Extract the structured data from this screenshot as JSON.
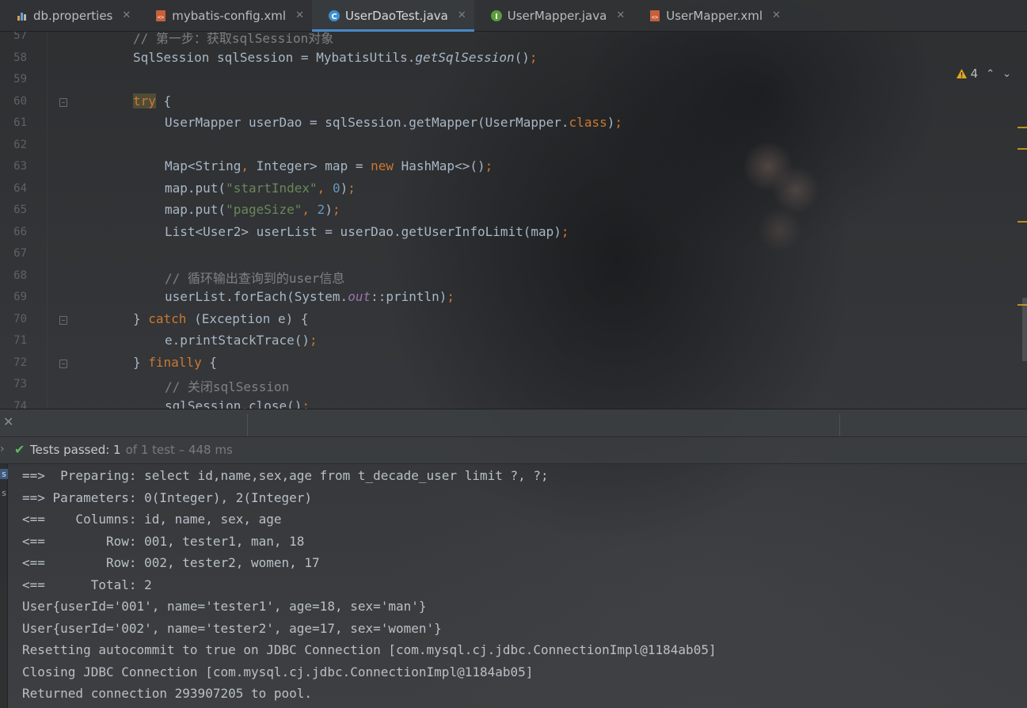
{
  "tabs": [
    {
      "label": "db.properties",
      "icon": "properties-file-icon",
      "active": false
    },
    {
      "label": "mybatis-config.xml",
      "icon": "xml-file-icon",
      "active": false
    },
    {
      "label": "UserDaoTest.java",
      "icon": "java-class-icon",
      "active": true
    },
    {
      "label": "UserMapper.java",
      "icon": "java-interface-icon",
      "active": false
    },
    {
      "label": "UserMapper.xml",
      "icon": "xml-file-icon",
      "active": false
    }
  ],
  "inspections": {
    "warning_count": "4"
  },
  "editor": {
    "lines": [
      {
        "num": "57",
        "indent": 0,
        "tokens": [
          {
            "t": "// 第一步：获取sqlSession对象",
            "c": "cmt"
          }
        ]
      },
      {
        "num": "58",
        "indent": 0,
        "tokens": [
          {
            "t": "SqlSession sqlSession = MybatisUtils."
          },
          {
            "t": "getSqlSession",
            "c": "it"
          },
          {
            "t": "()"
          },
          {
            "t": ";",
            "c": "kw"
          }
        ]
      },
      {
        "num": "59",
        "indent": 0,
        "tokens": []
      },
      {
        "num": "60",
        "indent": 0,
        "fold": true,
        "tokens": [
          {
            "t": "try",
            "c": "kw try-hl"
          },
          {
            "t": " {"
          }
        ]
      },
      {
        "num": "61",
        "indent": 1,
        "tokens": [
          {
            "t": "UserMapper userDao = sqlSession.getMapper(UserMapper."
          },
          {
            "t": "class",
            "c": "kw"
          },
          {
            "t": ")"
          },
          {
            "t": ";",
            "c": "kw"
          }
        ]
      },
      {
        "num": "62",
        "indent": 1,
        "tokens": []
      },
      {
        "num": "63",
        "indent": 1,
        "tokens": [
          {
            "t": "Map<String"
          },
          {
            "t": ",",
            "c": "kw"
          },
          {
            "t": " Integer> map = "
          },
          {
            "t": "new",
            "c": "kw"
          },
          {
            "t": " HashMap<>()"
          },
          {
            "t": ";",
            "c": "kw"
          }
        ]
      },
      {
        "num": "64",
        "indent": 1,
        "tokens": [
          {
            "t": "map.put("
          },
          {
            "t": "\"startIndex\"",
            "c": "str"
          },
          {
            "t": ",",
            "c": "kw"
          },
          {
            "t": " "
          },
          {
            "t": "0",
            "c": "num"
          },
          {
            "t": ")"
          },
          {
            "t": ";",
            "c": "kw"
          }
        ]
      },
      {
        "num": "65",
        "indent": 1,
        "tokens": [
          {
            "t": "map.put("
          },
          {
            "t": "\"pageSize\"",
            "c": "str"
          },
          {
            "t": ",",
            "c": "kw"
          },
          {
            "t": " "
          },
          {
            "t": "2",
            "c": "num"
          },
          {
            "t": ")"
          },
          {
            "t": ";",
            "c": "kw"
          }
        ]
      },
      {
        "num": "66",
        "indent": 1,
        "tokens": [
          {
            "t": "List<User2> userList = userDao.getUserInfoLimit(map)"
          },
          {
            "t": ";",
            "c": "kw"
          }
        ]
      },
      {
        "num": "67",
        "indent": 1,
        "tokens": []
      },
      {
        "num": "68",
        "indent": 1,
        "tokens": [
          {
            "t": "// 循环输出查询到的user信息",
            "c": "cmt"
          }
        ]
      },
      {
        "num": "69",
        "indent": 1,
        "tokens": [
          {
            "t": "userList.forEach(System."
          },
          {
            "t": "out",
            "c": "fld"
          },
          {
            "t": "::println)"
          },
          {
            "t": ";",
            "c": "kw"
          }
        ]
      },
      {
        "num": "70",
        "indent": 0,
        "fold": true,
        "tokens": [
          {
            "t": "} "
          },
          {
            "t": "catch",
            "c": "kw"
          },
          {
            "t": " (Exception e) {"
          }
        ]
      },
      {
        "num": "71",
        "indent": 1,
        "tokens": [
          {
            "t": "e.printStackTrace()"
          },
          {
            "t": ";",
            "c": "kw"
          }
        ]
      },
      {
        "num": "72",
        "indent": 0,
        "fold": true,
        "tokens": [
          {
            "t": "} "
          },
          {
            "t": "finally",
            "c": "kw"
          },
          {
            "t": " {"
          }
        ]
      },
      {
        "num": "73",
        "indent": 1,
        "tokens": [
          {
            "t": "// 关闭sqlSession",
            "c": "cmt"
          }
        ]
      },
      {
        "num": "74",
        "indent": 1,
        "tokens": [
          {
            "t": "sqlSession.close()"
          },
          {
            "t": ";",
            "c": "kw"
          }
        ]
      }
    ]
  },
  "test_status": {
    "label": "Tests passed: 1",
    "meta": "of 1 test – 448 ms"
  },
  "console": {
    "side_tabs": [
      "s",
      "s"
    ],
    "lines": [
      "==>  Preparing: select id,name,sex,age from t_decade_user limit ?, ?;",
      "==> Parameters: 0(Integer), 2(Integer)",
      "<==    Columns: id, name, sex, age",
      "<==        Row: 001, tester1, man, 18",
      "<==        Row: 002, tester2, women, 17",
      "<==      Total: 2",
      "User{userId='001', name='tester1', age=18, sex='man'}",
      "User{userId='002', name='tester2', age=17, sex='women'}",
      "Resetting autocommit to true on JDBC Connection [com.mysql.cj.jdbc.ConnectionImpl@1184ab05]",
      "Closing JDBC Connection [com.mysql.cj.jdbc.ConnectionImpl@1184ab05]",
      "Returned connection 293907205 to pool."
    ]
  },
  "colors": {
    "keyword": "#cc7832",
    "string": "#6a8759",
    "number": "#6897bb",
    "comment": "#808080",
    "field": "#9876aa",
    "pass_check": "#5fb85f",
    "active_tab_underline": "#4a88c7",
    "warning": "#be9117"
  }
}
